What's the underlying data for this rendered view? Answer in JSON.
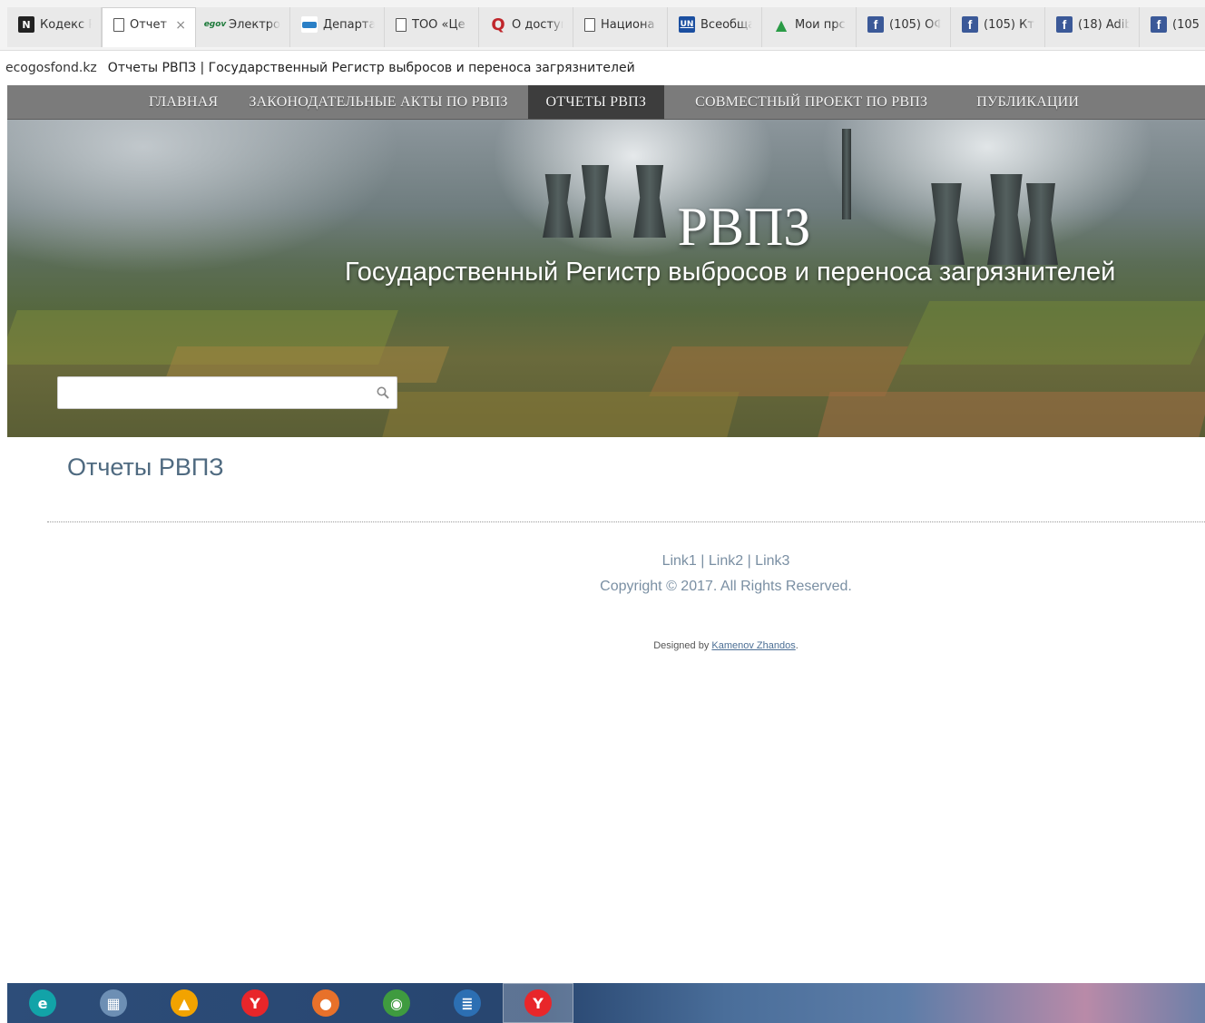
{
  "browser": {
    "tabs": [
      {
        "icon": "kodeks-icon",
        "label": "Кодекс Р",
        "active": false
      },
      {
        "icon": "document-icon",
        "label": "Отчет",
        "active": true
      },
      {
        "icon": "egov-icon",
        "label": "Электро",
        "active": false
      },
      {
        "icon": "department-icon",
        "label": "Департа",
        "active": false
      },
      {
        "icon": "document-icon",
        "label": "ТОО «Це",
        "active": false
      },
      {
        "icon": "search-icon",
        "label": "О доступ",
        "active": false
      },
      {
        "icon": "document-icon",
        "label": "Национа",
        "active": false
      },
      {
        "icon": "un-icon",
        "label": "Всеобща",
        "active": false
      },
      {
        "icon": "moi-icon",
        "label": "Мои прс",
        "active": false
      },
      {
        "icon": "facebook-icon",
        "label": "(105) ОФ",
        "active": false
      },
      {
        "icon": "facebook-icon",
        "label": "(105) Кто",
        "active": false
      },
      {
        "icon": "facebook-icon",
        "label": "(18) Adib",
        "active": false
      },
      {
        "icon": "facebook-icon",
        "label": "(105",
        "active": false
      }
    ],
    "close_glyph": "×",
    "egov_text": "egov",
    "un_text": "UN",
    "facebook_text": "f",
    "address": {
      "domain": "ecogosfond.kz",
      "title": "Отчеты РВПЗ | Государственный Регистр выбросов и переноса загрязнителей"
    }
  },
  "nav": {
    "items": [
      {
        "label": "ГЛАВНАЯ",
        "active": false
      },
      {
        "label": "ЗАКОНОДАТЕЛЬНЫЕ АКТЫ ПО РВПЗ",
        "active": false
      },
      {
        "label": "ОТЧЕТЫ РВПЗ",
        "active": true
      },
      {
        "label": "СОВМЕСТНЫЙ ПРОЕКТ ПО РВПЗ",
        "active": false
      },
      {
        "label": "ПУБЛИКАЦИИ",
        "active": false
      }
    ]
  },
  "hero": {
    "title": "РВПЗ",
    "subtitle": "Государственный Регистр выбросов и переноса загрязнителей",
    "search": {
      "value": "",
      "icon": "search-icon"
    }
  },
  "content": {
    "heading": "Отчеты РВПЗ"
  },
  "footer": {
    "links": [
      "Link1",
      "Link2",
      "Link3"
    ],
    "separator": " | ",
    "copyright": "Copyright © 2017. All Rights Reserved.",
    "designed_prefix": "Designed by ",
    "designer": "Kamenov Zhandos",
    "designed_suffix": "."
  },
  "taskbar": {
    "apps": [
      {
        "icon": "eset-icon",
        "glyph": "e",
        "color": "#12a3a8",
        "active": false
      },
      {
        "icon": "calculator-icon",
        "glyph": "▦",
        "color": "#6d8fb4",
        "active": false
      },
      {
        "icon": "archicad-icon",
        "glyph": "▲",
        "color": "#f2a300",
        "active": false
      },
      {
        "icon": "yandex-browser-icon",
        "glyph": "Y",
        "color": "#e8262a",
        "active": false
      },
      {
        "icon": "firefox-icon",
        "glyph": "●",
        "color": "#e8712a",
        "active": false
      },
      {
        "icon": "chrome-icon",
        "glyph": "◉",
        "color": "#3f9b3f",
        "active": false
      },
      {
        "icon": "wordpad-icon",
        "glyph": "≣",
        "color": "#2c6fb3",
        "active": false
      },
      {
        "icon": "yandex-browser-icon",
        "glyph": "Y",
        "color": "#e8262a",
        "active": true
      }
    ]
  },
  "colors": {
    "nav_bg": "#7b7b7b",
    "nav_active_bg": "#3d3d3d",
    "heading": "#4f6a80",
    "footer_text": "#7a8fa3"
  }
}
